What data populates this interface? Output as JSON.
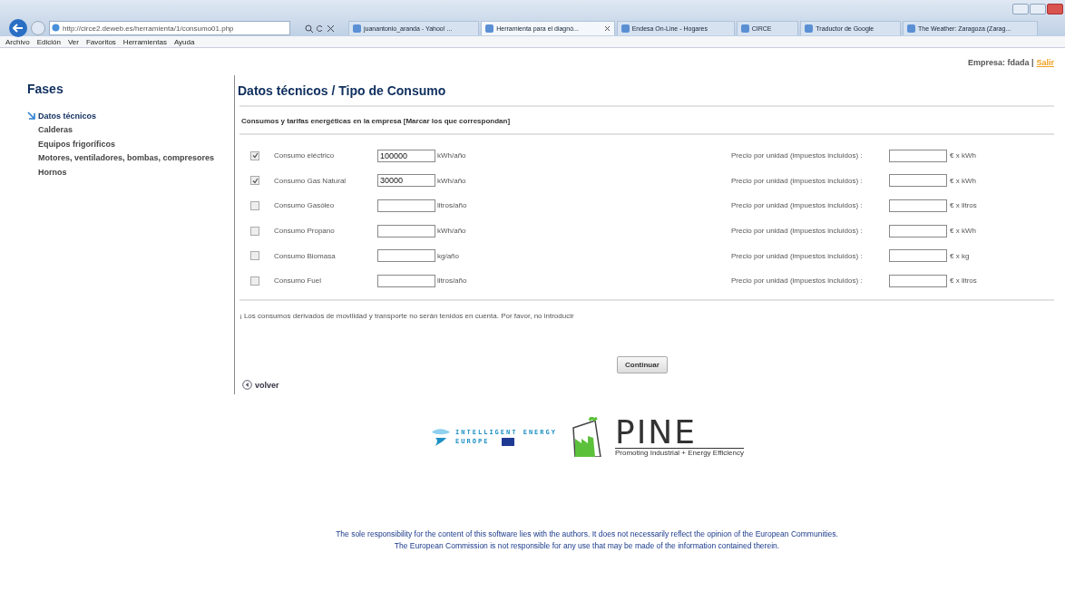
{
  "browser": {
    "address": "http://circe2.deweb.es/herramienta/1/consumo01.php",
    "tabs": [
      {
        "label": "juanantonio_aranda - Yahoo! ...",
        "selected": false
      },
      {
        "label": "Herramienta para el diagnó...",
        "selected": true
      },
      {
        "label": "Endesa On-Line - Hogares",
        "selected": false
      },
      {
        "label": "CIRCE",
        "selected": false
      },
      {
        "label": "Traductor de Google",
        "selected": false
      },
      {
        "label": "The Weather: Zaragoza (Zarag...",
        "selected": false
      }
    ],
    "menu": [
      "Archivo",
      "Edición",
      "Ver",
      "Favoritos",
      "Herramientas",
      "Ayuda"
    ]
  },
  "user": {
    "label": "Empresa: fdada |",
    "logout": "Salir"
  },
  "sidebar": {
    "title": "Fases",
    "items": [
      {
        "label": "Datos técnicos",
        "selected": true
      },
      {
        "label": "Calderas",
        "selected": false
      },
      {
        "label": "Equipos frigoríficos",
        "selected": false
      },
      {
        "label": "Motores, ventiladores, bombas, compresores",
        "selected": false
      },
      {
        "label": "Hornos",
        "selected": false
      }
    ]
  },
  "main": {
    "title": "Datos técnicos / Tipo de Consumo",
    "subtitle": "Consumos y tarifas energéticas en la empresa [Marcar los que correspondan]",
    "rows": [
      {
        "checked": true,
        "label": "Consumo eléctrico",
        "value": "100000",
        "unit": "kWh/año",
        "price_label": "Precio por unidad (impuestos incluidos) :",
        "price_unit": "€ x kWh"
      },
      {
        "checked": true,
        "label": "Consumo Gas Natural",
        "value": "30000",
        "unit": "kWh/año",
        "price_label": "Precio por unidad (impuestos incluidos) :",
        "price_unit": "€ x kWh"
      },
      {
        "checked": false,
        "label": "Consumo Gasóleo",
        "unit": "litros/año",
        "price_label": "Precio por unidad (impuestos incluidos) :",
        "price_unit": "€ x litros"
      },
      {
        "checked": false,
        "label": "Consumo Propano",
        "unit": "kWh/año",
        "price_label": "Precio por unidad (impuestos incluidos) :",
        "price_unit": "€ x kWh"
      },
      {
        "checked": false,
        "label": "Consumo Biomasa",
        "unit": "kg/año",
        "price_label": "Precio por unidad (impuestos incluidos) :",
        "price_unit": "€ x kg"
      },
      {
        "checked": false,
        "label": "Consumo Fuel",
        "unit": "litros/año",
        "price_label": "Precio por unidad (impuestos incluidos) :",
        "price_unit": "€ x litros"
      }
    ],
    "note": "¡ Los consumos derivados de movilidad y transporte no serán tenidos en cuenta. Por favor, no introducir",
    "continue": "Continuar",
    "back": "volver"
  },
  "logos": {
    "iee_line1": "INTELLIGENT ENERGY",
    "iee_line2": "EUROPE",
    "pine": "PINE",
    "pine_tagline": "Promoting Industrial + Energy Efficiency"
  },
  "footer": [
    "The sole responsibility for the content of this software lies with the authors. It does not necessarily reflect the opinion of the European Communities.",
    "The European Commission is not responsible for any use that may be made of the information contained therein."
  ]
}
